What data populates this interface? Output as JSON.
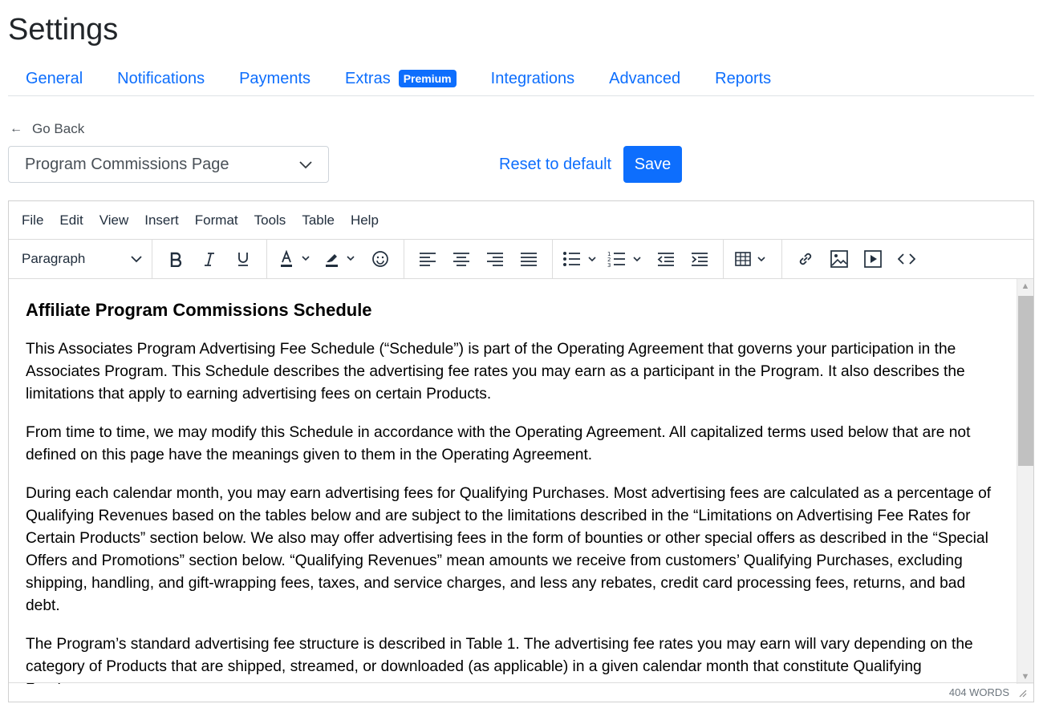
{
  "page": {
    "title": "Settings"
  },
  "tabs": [
    {
      "label": "General"
    },
    {
      "label": "Notifications"
    },
    {
      "label": "Payments"
    },
    {
      "label": "Extras",
      "badge": "Premium"
    },
    {
      "label": "Integrations"
    },
    {
      "label": "Advanced"
    },
    {
      "label": "Reports"
    }
  ],
  "go_back": {
    "label": "Go Back",
    "icon": "arrow-left-icon"
  },
  "page_select": {
    "value": "Program Commissions Page"
  },
  "actions": {
    "reset_label": "Reset to default",
    "save_label": "Save"
  },
  "colors": {
    "accent": "#0d6efd",
    "text": "#212529"
  },
  "editor": {
    "menubar": [
      "File",
      "Edit",
      "View",
      "Insert",
      "Format",
      "Tools",
      "Table",
      "Help"
    ],
    "block_format": "Paragraph",
    "toolbar_icons": [
      "bold-icon",
      "italic-icon",
      "underline-icon",
      "text-color-icon",
      "highlight-color-icon",
      "emoji-icon",
      "align-left-icon",
      "align-center-icon",
      "align-right-icon",
      "align-justify-icon",
      "bullet-list-icon",
      "numbered-list-icon",
      "outdent-icon",
      "indent-icon",
      "table-icon",
      "link-icon",
      "image-icon",
      "media-icon",
      "source-code-icon"
    ],
    "content": {
      "heading": "Affiliate Program Commissions Schedule",
      "paragraphs": [
        "This Associates Program Advertising Fee Schedule (“Schedule”) is part of the Operating Agreement that governs your participation in the Associates Program. This Schedule describes the advertising fee rates you may earn as a participant in the Program. It also describes the limitations that apply to earning advertising fees on certain Products.",
        "From time to time, we may modify this Schedule in accordance with the Operating Agreement. All capitalized terms used below that are not defined on this page have the meanings given to them in the Operating Agreement.",
        "During each calendar month, you may earn advertising fees for Qualifying Purchases. Most advertising fees are calculated as a percentage of Qualifying Revenues based on the tables below and are subject to the limitations described in the “Limitations on Advertising Fee Rates for Certain Products” section below. We also may offer advertising fees in the form of bounties or other special offers as described in the “Special Offers and Promotions” section below. “Qualifying Revenues” mean amounts we receive from customers’ Qualifying Purchases, excluding shipping, handling, and gift-wrapping fees, taxes, and service charges, and less any rebates, credit card processing fees, returns, and bad debt.",
        "The Program’s standard advertising fee structure is described in Table 1. The advertising fee rates you may earn will vary depending on the category of Products that are shipped, streamed, or downloaded (as applicable) in a given calendar month that constitute Qualifying Purchases."
      ]
    },
    "word_count": "404 WORDS"
  }
}
